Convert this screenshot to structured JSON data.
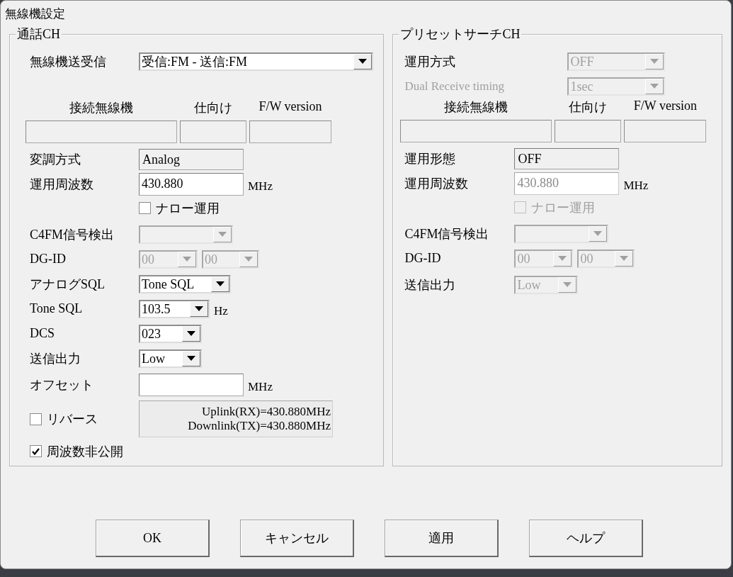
{
  "window": {
    "title": "無線機設定"
  },
  "groups": [
    {
      "title": "通話CH",
      "rows": [
        {
          "kind": "field",
          "label": "無線機送受信",
          "controls": [
            {
              "kind": "combo",
              "value": "受信:FM - 送信:FM",
              "disabled": false
            }
          ]
        },
        {
          "kind": "device",
          "headers": [
            "接続無線機",
            "仕向け",
            "F/W version"
          ]
        },
        {
          "kind": "field",
          "label": "変調方式",
          "controls": [
            {
              "kind": "static",
              "value": "Analog"
            }
          ]
        },
        {
          "kind": "field",
          "label": "運用周波数",
          "controls": [
            {
              "kind": "edit",
              "value": "430.880",
              "disabled": false
            }
          ],
          "unit": "MHz"
        },
        {
          "kind": "option",
          "label": "ナロー運用",
          "checked": false,
          "disabled": false
        },
        {
          "kind": "field",
          "label": "C4FM信号検出",
          "controls": [
            {
              "kind": "combo",
              "disabled": true
            }
          ]
        },
        {
          "kind": "field",
          "label": "DG-ID",
          "controls": [
            {
              "kind": "combo",
              "value": "00",
              "disabled": true
            },
            {
              "kind": "combo",
              "value": "00",
              "disabled": true
            }
          ]
        },
        {
          "kind": "field",
          "label": "アナログSQL",
          "controls": [
            {
              "kind": "combo",
              "value": "Tone SQL",
              "disabled": false
            }
          ]
        },
        {
          "kind": "field",
          "label": "Tone SQL",
          "controls": [
            {
              "kind": "combo",
              "value": "103.5",
              "disabled": false
            }
          ],
          "unit": "Hz"
        },
        {
          "kind": "field",
          "label": "DCS",
          "controls": [
            {
              "kind": "combo",
              "value": "023",
              "disabled": false
            }
          ]
        },
        {
          "kind": "field",
          "label": "送信出力",
          "controls": [
            {
              "kind": "combo",
              "value": "Low",
              "disabled": false
            }
          ]
        },
        {
          "kind": "field",
          "label": "オフセット",
          "controls": [
            {
              "kind": "edit",
              "disabled": false
            }
          ],
          "unit": "MHz"
        },
        {
          "kind": "reverse",
          "label": "リバース",
          "checked": false,
          "lines": [
            "Uplink(RX)=430.880MHz",
            "Downlink(TX)=430.880MHz"
          ]
        },
        {
          "kind": "check",
          "label": "周波数非公開",
          "checked": true
        }
      ]
    },
    {
      "title": "プリセットサーチCH",
      "rows": [
        {
          "kind": "field",
          "label": "運用方式",
          "controls": [
            {
              "kind": "combo",
              "value": "OFF",
              "disabled": true
            }
          ]
        },
        {
          "kind": "field",
          "label": "Dual Receive timing",
          "label_disabled": true,
          "controls": [
            {
              "kind": "combo",
              "value": "1sec",
              "disabled": true
            }
          ]
        },
        {
          "kind": "device",
          "headers": [
            "接続無線機",
            "仕向け",
            "F/W version"
          ]
        },
        {
          "kind": "field",
          "label": "運用形態",
          "controls": [
            {
              "kind": "static",
              "value": "OFF"
            }
          ]
        },
        {
          "kind": "field",
          "label": "運用周波数",
          "controls": [
            {
              "kind": "edit",
              "value": "430.880",
              "disabled": true
            }
          ],
          "unit": "MHz"
        },
        {
          "kind": "option",
          "label": "ナロー運用",
          "checked": false,
          "disabled": true
        },
        {
          "kind": "field",
          "label": "C4FM信号検出",
          "controls": [
            {
              "kind": "combo",
              "disabled": true
            }
          ]
        },
        {
          "kind": "field",
          "label": "DG-ID",
          "controls": [
            {
              "kind": "combo",
              "value": "00",
              "disabled": true
            },
            {
              "kind": "combo",
              "value": "00",
              "disabled": true
            }
          ]
        },
        {
          "kind": "field",
          "label": "送信出力",
          "controls": [
            {
              "kind": "combo",
              "value": "Low",
              "disabled": true
            }
          ]
        }
      ]
    }
  ],
  "buttons": [
    "OK",
    "キャンセル",
    "適用",
    "ヘルプ"
  ]
}
